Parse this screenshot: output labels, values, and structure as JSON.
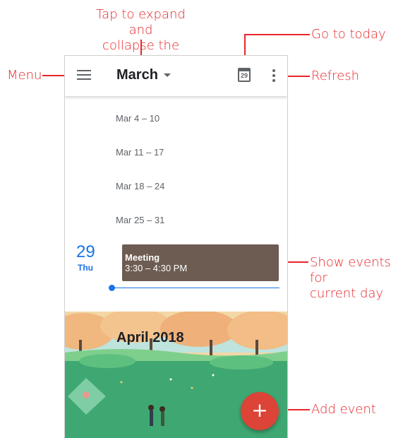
{
  "annotations": {
    "tap_expand_line1": "Tap to expand and",
    "tap_expand_line2": "collapse the month",
    "go_to_today": "Go to today",
    "menu": "Menu",
    "refresh": "Refresh",
    "show_events_line1": "Show events for",
    "show_events_line2": "current day",
    "add_event": "Add event"
  },
  "appbar": {
    "month": "March",
    "today_day": "29"
  },
  "weeks": [
    "Mar 4 – 10",
    "Mar 11 – 17",
    "Mar 18 – 24",
    "Mar 25 – 31"
  ],
  "today": {
    "day_number": "29",
    "day_name": "Thu",
    "event_title": "Meeting",
    "event_time": "3:30 – 4:30 PM"
  },
  "banner": {
    "title": "April 2018"
  },
  "fab": {
    "label": "+"
  },
  "colors": {
    "annotation": "#e8262a",
    "accent_blue": "#1a73e8",
    "event_bg": "#6d5c52",
    "fab": "#db4437"
  }
}
